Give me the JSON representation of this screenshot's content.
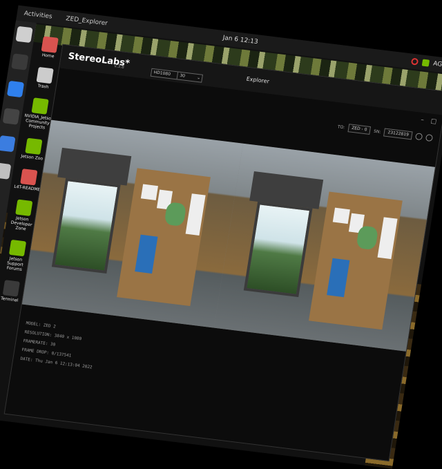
{
  "topbar": {
    "activities": "Activities",
    "app_name": "ZED_Explorer",
    "clock": "Jan 6 12:13",
    "tray_user": "AGX"
  },
  "dock": {
    "items": [
      {
        "name": "files-icon",
        "color": "#cfcfcf"
      },
      {
        "name": "terminal-icon",
        "color": "#3a3a3a"
      },
      {
        "name": "vscode-icon",
        "color": "#2f80ed"
      },
      {
        "name": "obs-icon",
        "color": "#444444"
      },
      {
        "name": "chromium-icon",
        "color": "#3b7de0"
      },
      {
        "name": "text-editor-icon",
        "color": "#bfbfbf"
      }
    ]
  },
  "desktop_icons": [
    {
      "label": "Home",
      "color": "#d9534f"
    },
    {
      "label": "Trash",
      "color": "#cccccc"
    },
    {
      "label": "NVIDIA_Jetson Community Projects",
      "color": "#76b900"
    },
    {
      "label": "Jetson Zoo",
      "color": "#76b900"
    },
    {
      "label": "L4T-README",
      "color": "#d9534f"
    },
    {
      "label": "Jetson Developer Zone",
      "color": "#76b900"
    },
    {
      "label": "Jetson Support Forums",
      "color": "#76b900"
    },
    {
      "label": "Terminal",
      "color": "#3a3a3a"
    }
  ],
  "window": {
    "brand": "StereoLabs*",
    "brand_sub": "v.3.8",
    "title": "Explorer",
    "resolution_select": "HD1080",
    "fps_select": "30",
    "controls": {
      "minimize": "–",
      "close": "□"
    }
  },
  "toolbar": {
    "label": "TO:",
    "camera_select": "ZED - 0",
    "info_label": "SN:",
    "serial_value": "23122819"
  },
  "info_panel": [
    "MODEL:   ZED 2",
    "RESOLUTION:  3840 x 1080",
    "FRAMERATE:  30",
    "FRAME DROP:  0/137541",
    "DATE:  Thu Jan 6 12:13:04 2022"
  ]
}
